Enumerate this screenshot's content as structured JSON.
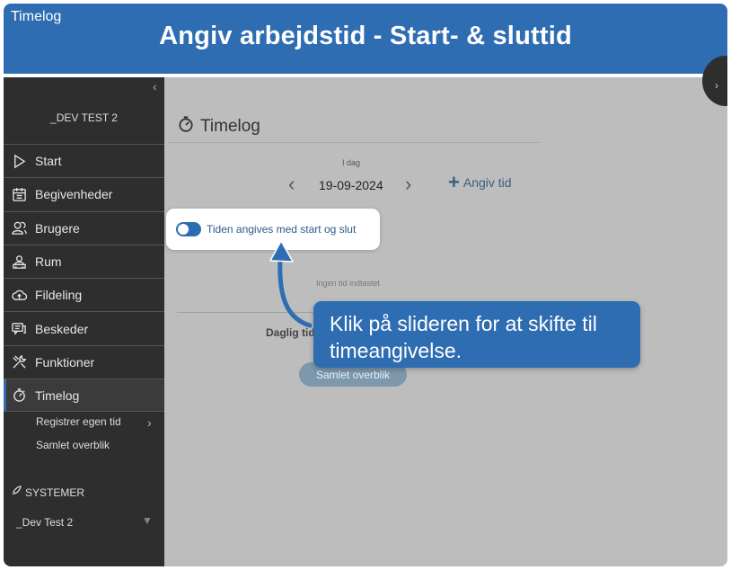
{
  "banner": {
    "app_name": "Timelog",
    "title": "Angiv arbejdstid - Start- & sluttid"
  },
  "sidebar": {
    "collapse_icon": "chevron-left-icon",
    "org_name": "_DEV TEST 2",
    "items": [
      {
        "label": "Start",
        "icon": "play-icon"
      },
      {
        "label": "Begivenheder",
        "icon": "calendar-icon"
      },
      {
        "label": "Brugere",
        "icon": "users-icon"
      },
      {
        "label": "Rum",
        "icon": "room-icon"
      },
      {
        "label": "Fildeling",
        "icon": "cloud-icon"
      },
      {
        "label": "Beskeder",
        "icon": "messages-icon"
      },
      {
        "label": "Funktioner",
        "icon": "tools-icon"
      },
      {
        "label": "Timelog",
        "icon": "stopwatch-icon",
        "active": true
      }
    ],
    "sub_items": [
      {
        "label": "Registrer egen tid"
      },
      {
        "label": "Samlet overblik"
      }
    ],
    "systems_label": "SYSTEMER",
    "system_name": "_Dev Test 2"
  },
  "main": {
    "title": "Timelog",
    "today_label": "I dag",
    "date": "19-09-2024",
    "add_time_label": "Angiv tid",
    "toggle_label": "Tiden angives med start og slut",
    "no_time_label": "Ingen tid indtastet",
    "daily_label": "Daglig tid",
    "overview_button": "Samlet overblik"
  },
  "callout": {
    "text_line1": "Klik på slideren for at skifte til",
    "text_line2": "timeangivelse."
  },
  "colors": {
    "accent": "#2f6db2",
    "sidebar": "#2e2e2e",
    "overlay": "#bdbdbd"
  }
}
